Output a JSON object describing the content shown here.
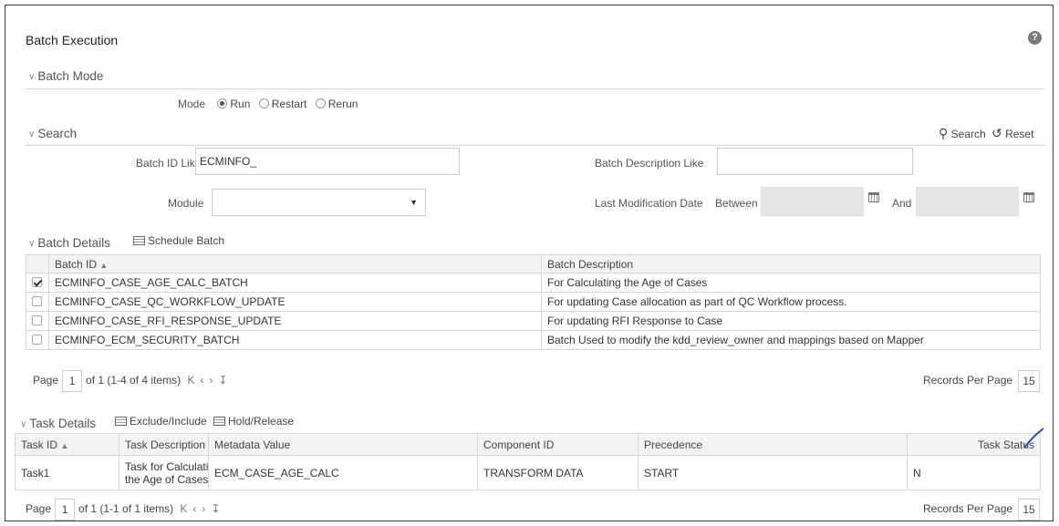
{
  "page": {
    "title": "Batch Execution",
    "help": "?"
  },
  "batch_mode": {
    "heading": "Batch Mode",
    "mode_label": "Mode",
    "options": [
      "Run",
      "Restart",
      "Rerun"
    ],
    "selected": "Run"
  },
  "search": {
    "heading": "Search",
    "search_label": "Search",
    "reset_label": "Reset",
    "batch_id_label": "Batch ID Like",
    "batch_id_value": "ECMINFO_",
    "batch_desc_label": "Batch Description Like",
    "batch_desc_value": "",
    "module_label": "Module",
    "module_value": "",
    "last_mod_label": "Last Modification Date",
    "between_label": "Between",
    "and_label": "And"
  },
  "batch_details": {
    "heading": "Batch Details",
    "schedule_label": "Schedule Batch",
    "columns": [
      "Batch ID",
      "Batch Description"
    ],
    "rows": [
      {
        "checked": true,
        "id": "ECMINFO_CASE_AGE_CALC_BATCH",
        "desc": "For Calculating the Age of Cases"
      },
      {
        "checked": false,
        "id": "ECMINFO_CASE_QC_WORKFLOW_UPDATE",
        "desc": "For updating Case allocation as part of QC Workflow process."
      },
      {
        "checked": false,
        "id": "ECMINFO_CASE_RFI_RESPONSE_UPDATE",
        "desc": "For updating RFI Response to Case"
      },
      {
        "checked": false,
        "id": "ECMINFO_ECM_SECURITY_BATCH",
        "desc": "Batch Used to modify the kdd_review_owner and mappings based on Mapper"
      }
    ],
    "pager": {
      "page_label": "Page",
      "page": "1",
      "summary": "of 1 (1-4 of 4 items)",
      "rpp_label": "Records Per Page",
      "rpp": "15"
    }
  },
  "task_details": {
    "heading": "Task Details",
    "exclude_label": "Exclude/Include",
    "hold_label": "Hold/Release",
    "columns": [
      "Task ID",
      "Task Description",
      "Metadata Value",
      "Component ID",
      "Precedence",
      "Task Status"
    ],
    "rows": [
      {
        "task_id": "Task1",
        "desc_line1": "Task for Calculating",
        "desc_line2": "the Age of Cases",
        "metadata": "ECM_CASE_AGE_CALC",
        "component": "TRANSFORM DATA",
        "precedence": "START",
        "status": "N"
      }
    ],
    "pager": {
      "page_label": "Page",
      "page": "1",
      "summary": "of 1 (1-1 of 1 items)",
      "rpp_label": "Records Per Page",
      "rpp": "15"
    }
  },
  "icons": {
    "help": "help-icon",
    "search": "search-icon",
    "reset": "reset-icon",
    "calendar": "calendar-icon",
    "schedule": "schedule-icon",
    "sort": "sort-asc-icon"
  },
  "colors": {
    "border": "#d6d6d6",
    "header_bg": "#f3f3f3",
    "disabled_input": "#e6e6e6",
    "annotation": "#1f4fbf"
  }
}
